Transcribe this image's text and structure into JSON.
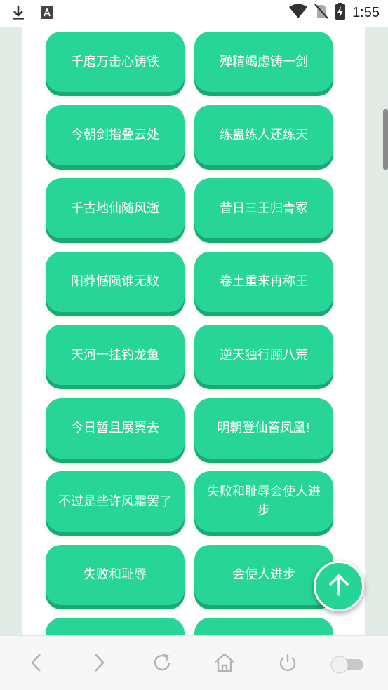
{
  "status_bar": {
    "time": "1:55",
    "icons": [
      "download-icon",
      "font-app-icon",
      "wifi-icon",
      "no-sim-icon",
      "battery-charging-icon"
    ]
  },
  "buttons": [
    {
      "label": "千磨万击心铸铁"
    },
    {
      "label": "殚精竭虑铸一剑"
    },
    {
      "label": "今朝剑指叠云处"
    },
    {
      "label": "练蛊练人还练天"
    },
    {
      "label": "千古地仙随风逝"
    },
    {
      "label": "昔日三王归青冢"
    },
    {
      "label": "阳莽憾陨谁无败"
    },
    {
      "label": "卷土重来再称王"
    },
    {
      "label": "天河一挂钓龙鱼"
    },
    {
      "label": "逆天独行顾八荒"
    },
    {
      "label": "今日暂且展翼去"
    },
    {
      "label": "明朝登仙笞凤凰!"
    },
    {
      "label": "不过是些许风霜罢了"
    },
    {
      "label": "失败和耻辱会使人进步"
    },
    {
      "label": "失败和耻辱"
    },
    {
      "label": "会使人进步"
    },
    {
      "label": ""
    },
    {
      "label": ""
    }
  ],
  "fab": {
    "icon": "arrow-up-icon"
  },
  "nav_bar": {
    "items": [
      "back-icon",
      "forward-icon",
      "refresh-icon",
      "home-icon",
      "power-icon",
      "toggle-switch"
    ]
  },
  "colors": {
    "button": "#27d596",
    "button_shadow": "#1aa874",
    "background": "#e3ebe6"
  }
}
